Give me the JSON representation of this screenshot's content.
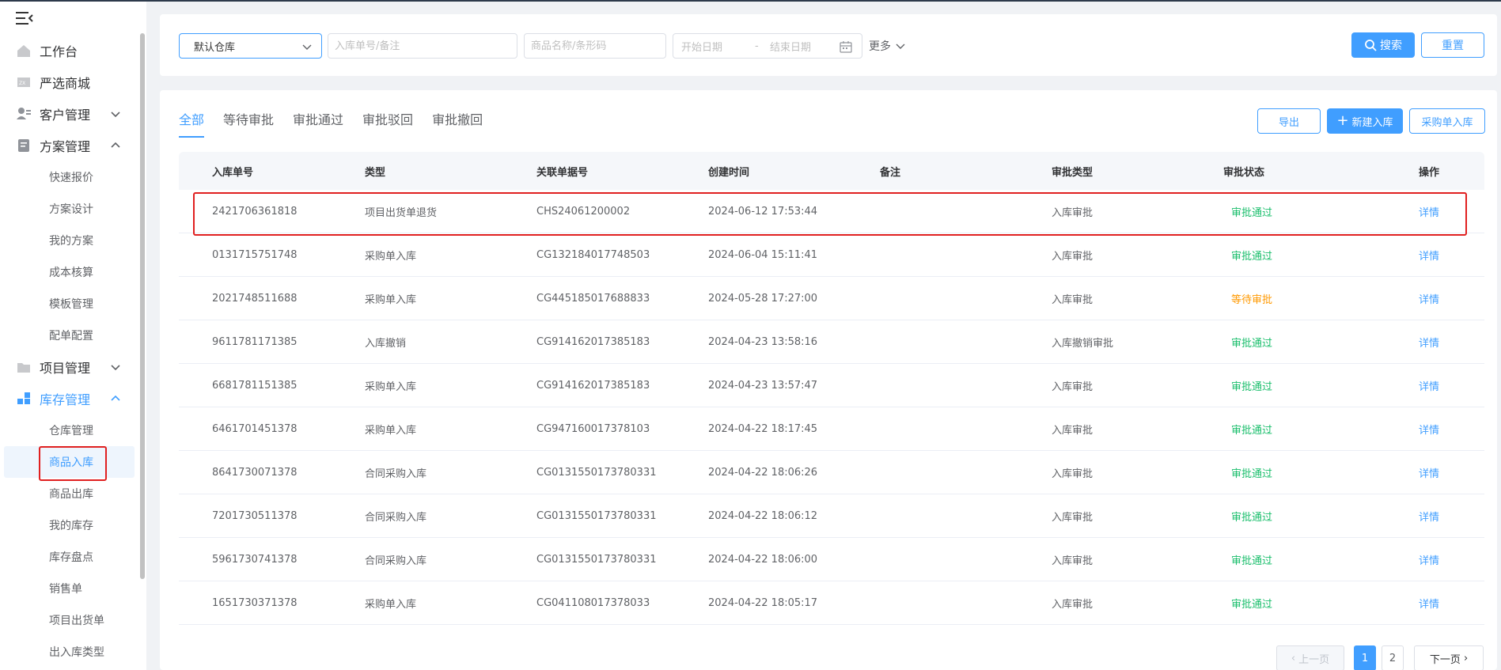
{
  "sidebar": {
    "items": [
      {
        "label": "工作台",
        "icon": "home-icon"
      },
      {
        "label": "严选商城",
        "icon": "shop-icon"
      },
      {
        "label": "客户管理",
        "icon": "customer-icon",
        "expanded": false
      },
      {
        "label": "方案管理",
        "icon": "plan-icon",
        "expanded": true
      }
    ],
    "plan_sub": [
      "快速报价",
      "方案设计",
      "我的方案",
      "成本核算",
      "模板管理",
      "配单配置"
    ],
    "project": {
      "label": "项目管理",
      "icon": "folder-icon",
      "expanded": false
    },
    "inventory": {
      "label": "库存管理",
      "icon": "inventory-icon",
      "expanded": true
    },
    "inventory_sub": [
      "仓库管理",
      "商品入库",
      "商品出库",
      "我的库存",
      "库存盘点",
      "销售单",
      "项目出货单",
      "出入库类型"
    ]
  },
  "filters": {
    "warehouse": "默认仓库",
    "order_placeholder": "入库单号/备注",
    "product_placeholder": "商品名称/条形码",
    "start_date": "开始日期",
    "dash": "-",
    "end_date": "结束日期",
    "more": "更多",
    "search": "搜索",
    "reset": "重置"
  },
  "tabs": [
    "全部",
    "等待审批",
    "审批通过",
    "审批驳回",
    "审批撤回"
  ],
  "actions": {
    "export": "导出",
    "new": "新建入库",
    "purchase": "采购单入库"
  },
  "table": {
    "headers": [
      "入库单号",
      "类型",
      "关联单据号",
      "创建时间",
      "备注",
      "审批类型",
      "审批状态",
      "操作"
    ],
    "rows": [
      [
        "2421706361818",
        "项目出货单退货",
        "CHS24061200002",
        "2024-06-12 17:53:44",
        "",
        "入库审批",
        "审批通过",
        "详情"
      ],
      [
        "0131715751748",
        "采购单入库",
        "CG132184017748503",
        "2024-06-04 15:11:41",
        "",
        "入库审批",
        "审批通过",
        "详情"
      ],
      [
        "2021748511688",
        "采购单入库",
        "CG445185017688833",
        "2024-05-28 17:27:00",
        "",
        "入库审批",
        "等待审批",
        "详情"
      ],
      [
        "9611781171385",
        "入库撤销",
        "CG914162017385183",
        "2024-04-23 13:58:16",
        "",
        "入库撤销审批",
        "审批通过",
        "详情"
      ],
      [
        "6681781151385",
        "采购单入库",
        "CG914162017385183",
        "2024-04-23 13:57:47",
        "",
        "入库审批",
        "审批通过",
        "详情"
      ],
      [
        "6461701451378",
        "采购单入库",
        "CG947160017378103",
        "2024-04-22 18:17:45",
        "",
        "入库审批",
        "审批通过",
        "详情"
      ],
      [
        "8641730071378",
        "合同采购入库",
        "CG0131550173780331",
        "2024-04-22 18:06:26",
        "",
        "入库审批",
        "审批通过",
        "详情"
      ],
      [
        "7201730511378",
        "合同采购入库",
        "CG0131550173780331",
        "2024-04-22 18:06:12",
        "",
        "入库审批",
        "审批通过",
        "详情"
      ],
      [
        "5961730741378",
        "合同采购入库",
        "CG0131550173780331",
        "2024-04-22 18:06:00",
        "",
        "入库审批",
        "审批通过",
        "详情"
      ],
      [
        "1651730371378",
        "采购单入库",
        "CG041108017378033",
        "2024-04-22 18:05:17",
        "",
        "入库审批",
        "审批通过",
        "详情"
      ]
    ]
  },
  "pagination": {
    "prev": "上一页",
    "pages": [
      "1",
      "2"
    ],
    "next": "下一页"
  },
  "colors": {
    "accent": "#409eff",
    "pass": "#19be6b",
    "wait": "#ff9900",
    "highlight": "#e02020"
  }
}
